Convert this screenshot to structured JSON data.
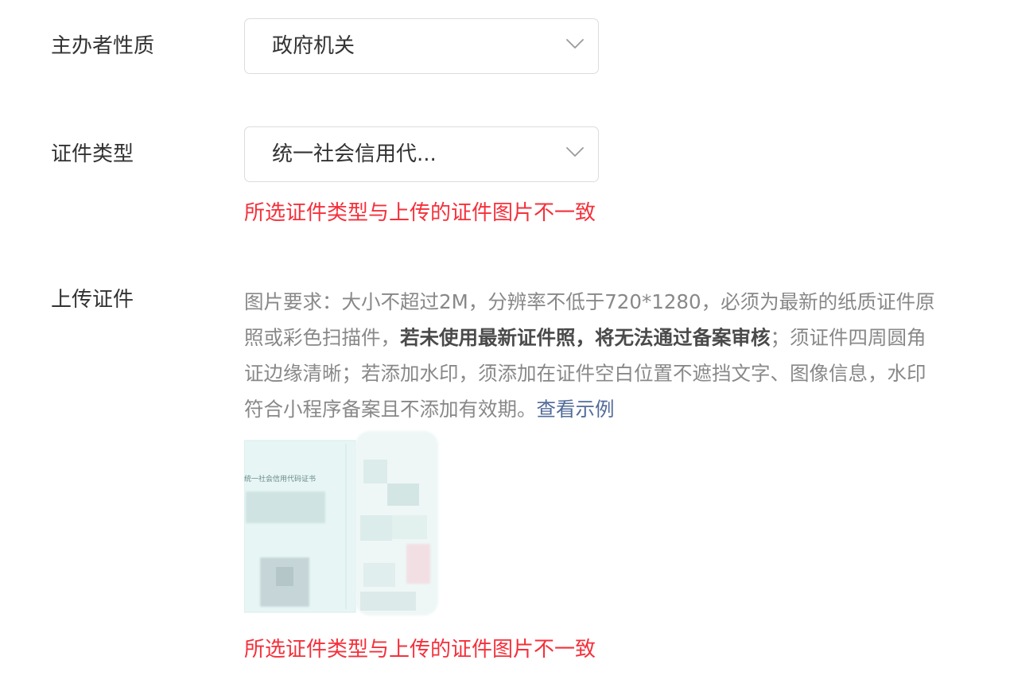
{
  "organizer": {
    "label": "主办者性质",
    "value": "政府机关"
  },
  "certificate_type": {
    "label": "证件类型",
    "value": "统一社会信用代...",
    "error": "所选证件类型与上传的证件图片不一致"
  },
  "upload": {
    "label": "上传证件",
    "requirements": {
      "line1": "图片要求：大小不超过2M，分辨率不低于720*1280，必须为最新的纸质证件原",
      "line2_a": "照或彩色扫描件，",
      "line2_bold": "若未使用最新证件照，将无法通过备案审核",
      "line2_b": "；须证件四周圆角",
      "line3": "证边缘清晰；若添加水印，须添加在证件空白位置不遮挡文字、图像信息，水印",
      "line4": "符合小程序备案且不添加有效期。",
      "link": "查看示例"
    },
    "image_caption": "统一社会信用代码证书",
    "error": "所选证件类型与上传的证件图片不一致"
  },
  "colors": {
    "error": "#f5303b",
    "link": "#526b99",
    "border": "#dcdcdc"
  },
  "icons": {
    "select_arrow": "chevron-down-icon"
  }
}
